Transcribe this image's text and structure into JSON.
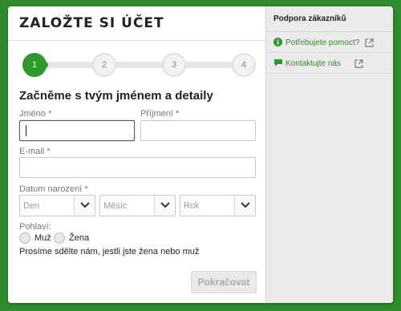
{
  "colors": {
    "accent": "#2e9a2e",
    "background": "#2e8b2e",
    "sidebar": "#ebebeb"
  },
  "form": {
    "title": "ZALOŽTE SI ÚČET",
    "steps": [
      "1",
      "2",
      "3",
      "4"
    ],
    "active_step": 1,
    "progress_fraction": 0.07,
    "heading": "Začněme s tvým jménem a detaily",
    "first_name": {
      "label": "Jméno *",
      "value": ""
    },
    "last_name": {
      "label": "Příjmení *",
      "value": ""
    },
    "email": {
      "label": "E-mail *",
      "value": ""
    },
    "dob": {
      "label": "Datum narození *",
      "day": "Den",
      "month": "Měsíc",
      "year": "Rok"
    },
    "gender": {
      "label": "Pohlaví:",
      "male": "Muž",
      "female": "Žena",
      "note": "Prosíme sdělte nám, jestli jste žena nebo muž"
    },
    "continue_label": "Pokračovat"
  },
  "sidebar": {
    "title": "Podpora zákazníků",
    "links": [
      {
        "label": "Potřebujete pomoct?",
        "icon": "info-icon"
      },
      {
        "label": "Kontaktujte nás",
        "icon": "chat-icon"
      }
    ]
  }
}
